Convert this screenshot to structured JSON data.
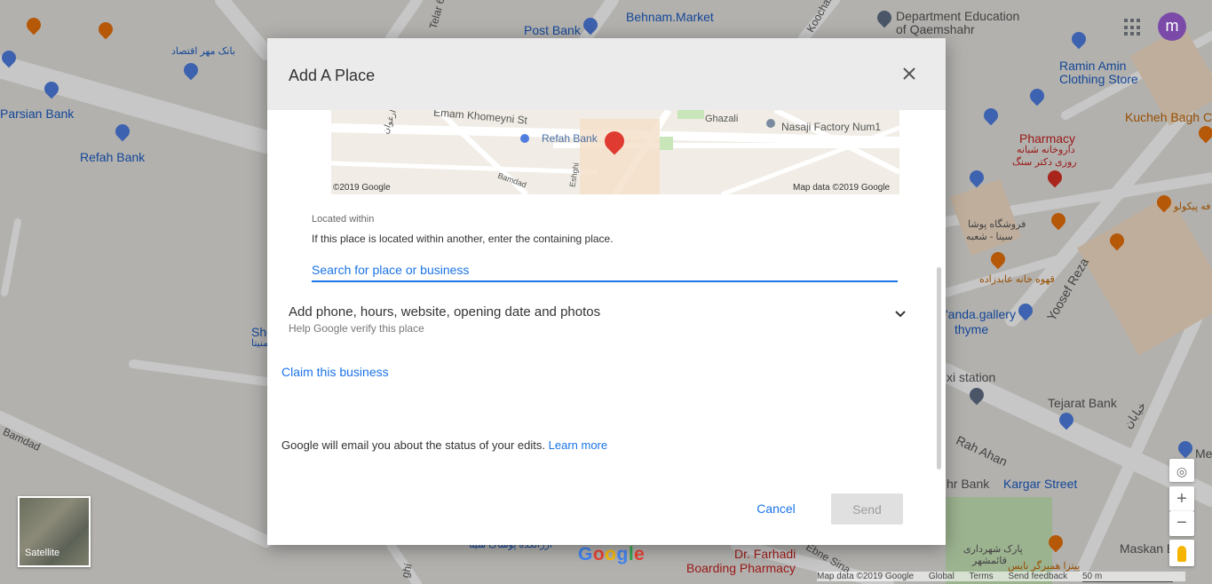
{
  "map": {
    "labels": {
      "post_bank": "Post Bank",
      "behnam_market": "Behnam.Market",
      "dept_education": "Department Education",
      "dept_education_2": "of Qaemshahr",
      "ramin_amin": "Ramin Amin",
      "ramin_amin_2": "Clothing Store",
      "kucheh_bagh": "Kucheh Bagh Ca",
      "pharmacy": "Pharmacy",
      "pharmacy_fa1": "داروخانه شبانه",
      "pharmacy_fa2": "روزی دکتر سنگ",
      "parsian_bank": "Parsian Bank",
      "refah_bank": "Refah Bank",
      "bank_mehr_fa": "بانک مهر اقتصاد",
      "telar": "Telar 6",
      "koochak": "Koochak",
      "farushgah_fa1": "فروشگاه پوشا",
      "farushgah_fa2": "سینا - شعبه",
      "ghahve_fa": "قهوه خانه عابدزاده",
      "fe_picolo_fa": "فه پیکولو",
      "yoosef_reza": "Yoosef Reza",
      "anda_gallery": "'anda.gallery",
      "thyme": "thyme",
      "taxi_station": "xi station",
      "tejarat_bank": "Tejarat Bank",
      "rah_ahan": "Rah Ahan",
      "kargar_street": "Kargar Street",
      "hr_bank": "hr Bank",
      "maskan": "Maskan B",
      "dr_farhadi": "Dr. Farhadi",
      "boarding_pharmacy": "Boarding Pharmacy",
      "park_fa1": "پارک شهرداری",
      "park_fa2": "قائمشهر",
      "pizza_fa": "پیتزا همبرگر نایس",
      "khiaban_fa": "خیابان",
      "bamdad": "Bamdad",
      "ebne_sina": "Ebne Sina",
      "sho": "Sho",
      "sho_fa": "منیتا",
      "ghi": "ghi",
      "arzadeh_fa": "ارزانکده پوشاک سینا",
      "me": "Me"
    },
    "satellite_label": "Satellite",
    "google_logo": "Google",
    "footer": [
      "Map data ©2019 Google",
      "Global",
      "Terms",
      "Send feedback",
      "50 m"
    ],
    "avatar_letter": "m",
    "zoom_in": "+",
    "zoom_out": "−"
  },
  "dialog": {
    "title": "Add A Place",
    "minimap": {
      "emam_khomeyni": "Emam Khomeyni St",
      "refah_bank": "Refah Bank",
      "ghazali": "Ghazali",
      "nasaji": "Nasaji Factory Num1",
      "bamdad": "Bamdad",
      "eshghi": "Eshghi",
      "arghavan_fa": "ارغوان",
      "copyright": "©2019 Google",
      "map_data": "Map data ©2019 Google"
    },
    "located_within_label": "Located within",
    "located_within_desc": "If this place is located within another, enter the containing place.",
    "search_placeholder": "Search for place or business",
    "expand_title": "Add phone, hours, website, opening date and photos",
    "expand_subtitle": "Help Google verify this place",
    "claim_link": "Claim this business",
    "notice_text": "Google will email you about the status of your edits.",
    "learn_more": "Learn more",
    "cancel_label": "Cancel",
    "send_label": "Send"
  }
}
